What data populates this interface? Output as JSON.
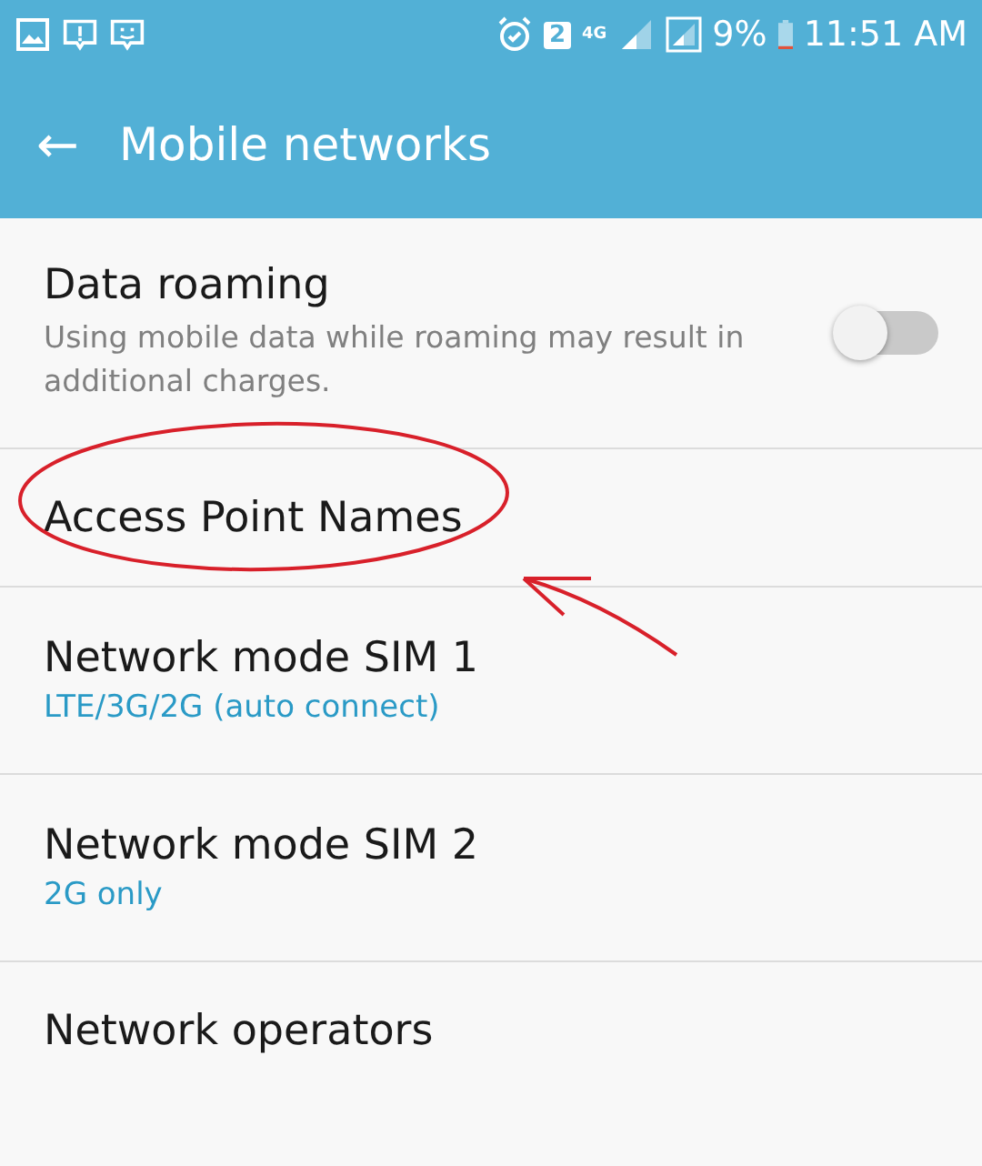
{
  "status_bar": {
    "sim_badge": "2",
    "network_type": "4G",
    "battery": "9%",
    "time": "11:51 AM"
  },
  "app_bar": {
    "back": "←",
    "title": "Mobile networks"
  },
  "settings": [
    {
      "kind": "toggle",
      "title": "Data roaming",
      "summary": "Using mobile data while roaming may result in additional charges.",
      "on": false
    },
    {
      "kind": "plain",
      "title": "Access Point Names"
    },
    {
      "kind": "value",
      "title": "Network mode SIM 1",
      "value": "LTE/3G/2G (auto connect)"
    },
    {
      "kind": "value",
      "title": "Network mode SIM 2",
      "value": "2G only"
    },
    {
      "kind": "plain",
      "title": "Network operators"
    }
  ]
}
